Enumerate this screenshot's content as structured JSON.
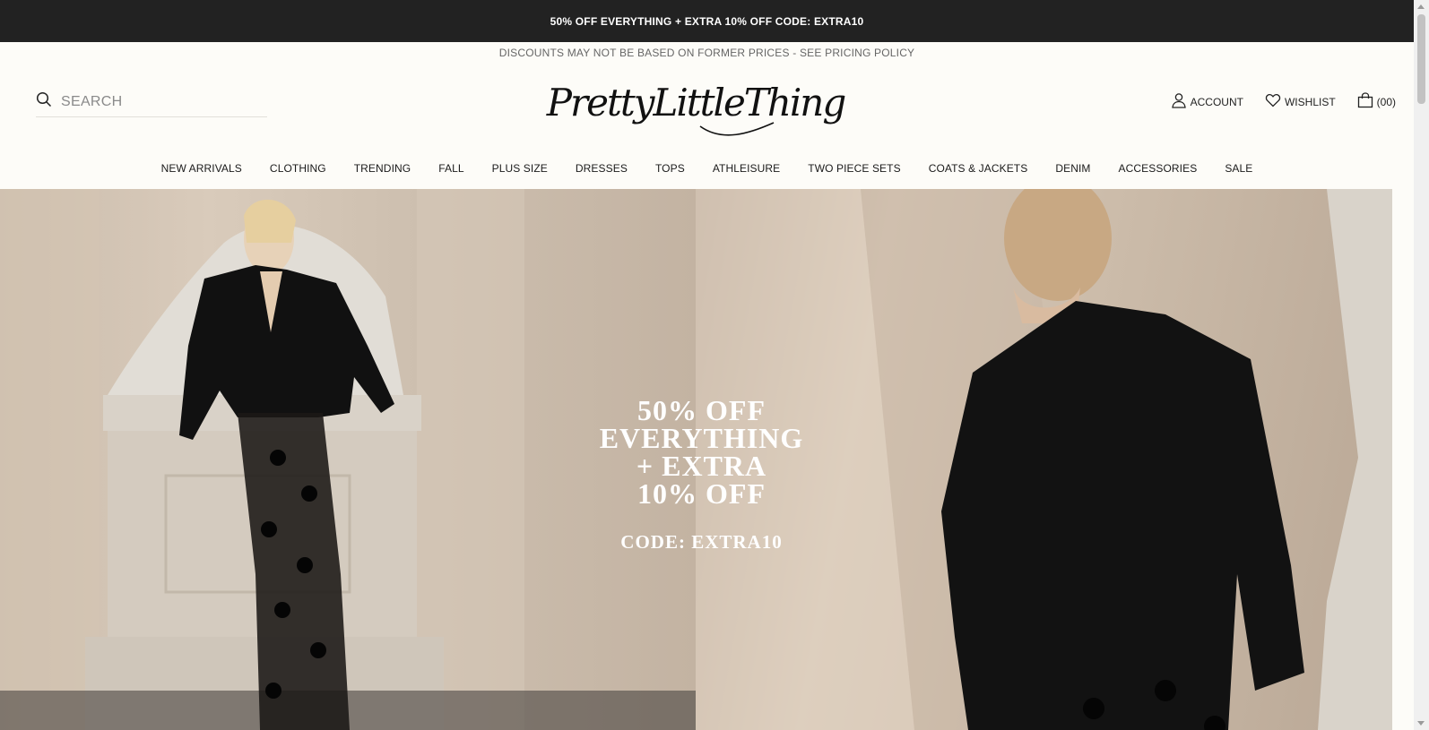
{
  "promo_bar": {
    "text": "50% OFF EVERYTHING + EXTRA 10% OFF CODE: EXTRA10"
  },
  "disclaimer": {
    "text": "DISCOUNTS MAY NOT BE BASED ON FORMER PRICES - SEE PRICING POLICY"
  },
  "search": {
    "placeholder": "SEARCH",
    "value": ""
  },
  "logo": {
    "text": "PrettyLittleThing"
  },
  "utils": {
    "account_label": "ACCOUNT",
    "wishlist_label": "WISHLIST",
    "bag_count": "(00)"
  },
  "nav": {
    "items": [
      {
        "label": "NEW ARRIVALS"
      },
      {
        "label": "CLOTHING"
      },
      {
        "label": "TRENDING"
      },
      {
        "label": "FALL"
      },
      {
        "label": "PLUS SIZE"
      },
      {
        "label": "DRESSES"
      },
      {
        "label": "TOPS"
      },
      {
        "label": "ATHLEISURE"
      },
      {
        "label": "TWO PIECE SETS"
      },
      {
        "label": "COATS & JACKETS"
      },
      {
        "label": "DENIM"
      },
      {
        "label": "ACCESSORIES"
      },
      {
        "label": "SALE"
      }
    ]
  },
  "hero": {
    "headline_lines": [
      "50% OFF",
      "EVERYTHING",
      "+ EXTRA",
      "10% OFF"
    ],
    "code": "CODE: EXTRA10"
  },
  "icons": {
    "search": "search-icon",
    "account": "user-icon",
    "wishlist": "heart-icon",
    "bag": "shopping-bag-icon"
  },
  "colors": {
    "promo_bg": "#222222",
    "page_bg": "#fdfcf8",
    "hero_text": "#ffffff"
  }
}
